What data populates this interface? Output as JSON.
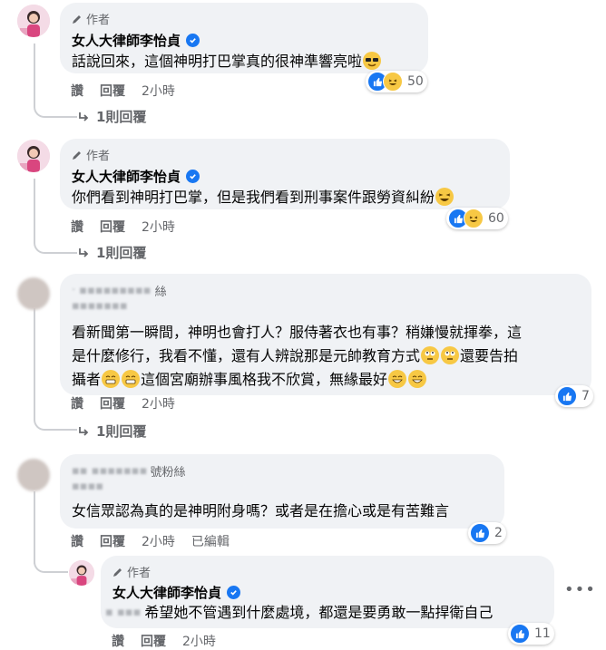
{
  "comments": [
    {
      "author_badge": "作者",
      "author_name": "女人大律師李怡貞",
      "text": "話說回來，這個神明打巴掌真的很神準響亮啦",
      "actions": {
        "like": "讚",
        "reply": "回覆",
        "time": "2小時"
      },
      "reactions_count": "50",
      "replies_link": "1則回覆"
    },
    {
      "author_badge": "作者",
      "author_name": "女人大律師李怡貞",
      "text": "你們看到神明打巴掌，但是我們看到刑事案件跟勞資糾紛",
      "actions": {
        "like": "讚",
        "reply": "回覆",
        "time": "2小時"
      },
      "reactions_count": "60",
      "replies_link": "1則回覆"
    },
    {
      "author_name_partial": "絲",
      "text_line1": "看新聞第一瞬間，神明也會打人？服侍著衣也有事？稍嫌慢就揮拳，這",
      "text_line2a": "是什麼修行，我看不懂，還有人辨說那是元帥教育方式",
      "text_line2b": "還要告拍",
      "text_line3a": "攝者",
      "text_line3b": "這個宮廟辦事風格我不欣賞，無緣最好",
      "actions": {
        "like": "讚",
        "reply": "回覆",
        "time": "2小時"
      },
      "reactions_count": "7",
      "replies_link": "1則回覆"
    },
    {
      "author_name_partial": "號粉絲",
      "text": "女信眾認為真的是神明附身嗎？或者是在擔心或是有苦難言",
      "actions": {
        "like": "讚",
        "reply": "回覆",
        "time": "2小時",
        "edited": "已編輯"
      },
      "reactions_count": "2"
    }
  ],
  "reply": {
    "author_badge": "作者",
    "author_name": "女人大律師李怡貞",
    "text": "希望她不管遇到什麼處境，都還是要勇敢一點捍衛自己",
    "actions": {
      "like": "讚",
      "reply": "回覆",
      "time": "2小時"
    },
    "reactions_count": "11"
  }
}
